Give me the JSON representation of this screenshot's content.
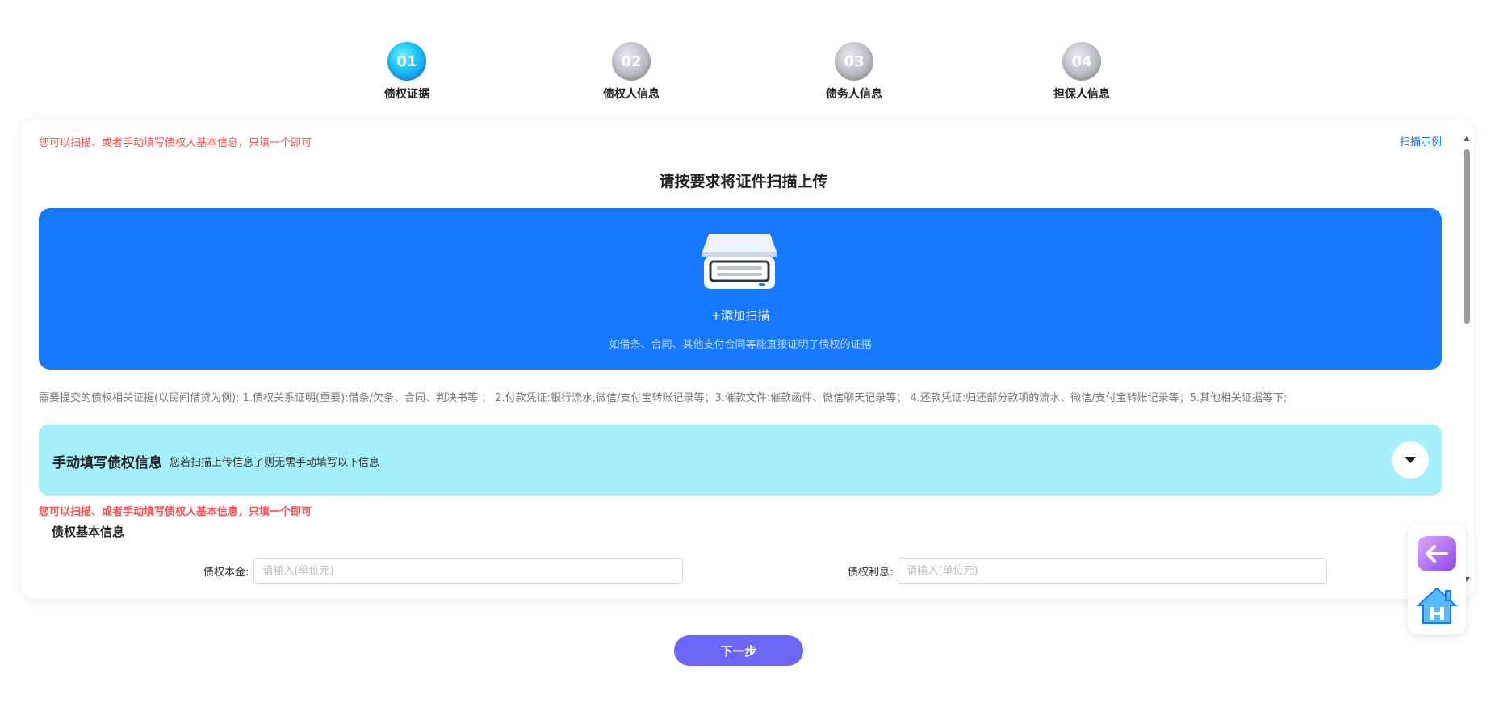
{
  "steps": [
    {
      "num": "01",
      "label": "债权证据",
      "state": "active"
    },
    {
      "num": "02",
      "label": "债权人信息",
      "state": "inactive"
    },
    {
      "num": "03",
      "label": "债务人信息",
      "state": "inactive"
    },
    {
      "num": "04",
      "label": "担保人信息",
      "state": "inactive"
    }
  ],
  "card": {
    "hint_top": "您可以扫描、或者手动填写债权人基本信息，只填一个即可",
    "scan_example": "扫描示例",
    "upload_title": "请按要求将证件扫描上传",
    "add_scan": "+添加扫描",
    "upload_sub": "如借条、合同、其他支付合同等能直接证明了债权的证据",
    "evidence_note": "需要提交的债权相关证据(以民间借贷为例): 1.债权关系证明(重要):借条/欠条、合同、判决书等 ； 2.付款凭证:银行流水,微信/支付宝转账记录等；3.催款文件:催款函件、微信聊天记录等； 4.还款凭证:归还部分款项的流水、微信/支付宝转账记录等；5.其他相关证据等下;",
    "manual_title": "手动填写债权信息",
    "manual_sub": "您若扫描上传信息了则无需手动填写以下信息",
    "hint_bold": "您可以扫描、或者手动填写债权人基本信息，只填一个即可",
    "section_title": "债权基本信息",
    "principal_label": "债权本金:",
    "principal_placeholder": "请输入(单位元)",
    "interest_label": "债权利息:",
    "interest_placeholder": "请输入(单位元)"
  },
  "next_button": "下一步",
  "colors": {
    "primary": "#1677ff",
    "warning": "#ff4d4f",
    "manual_bar": "#a5f0fb",
    "next_button": "#6b66f5"
  }
}
